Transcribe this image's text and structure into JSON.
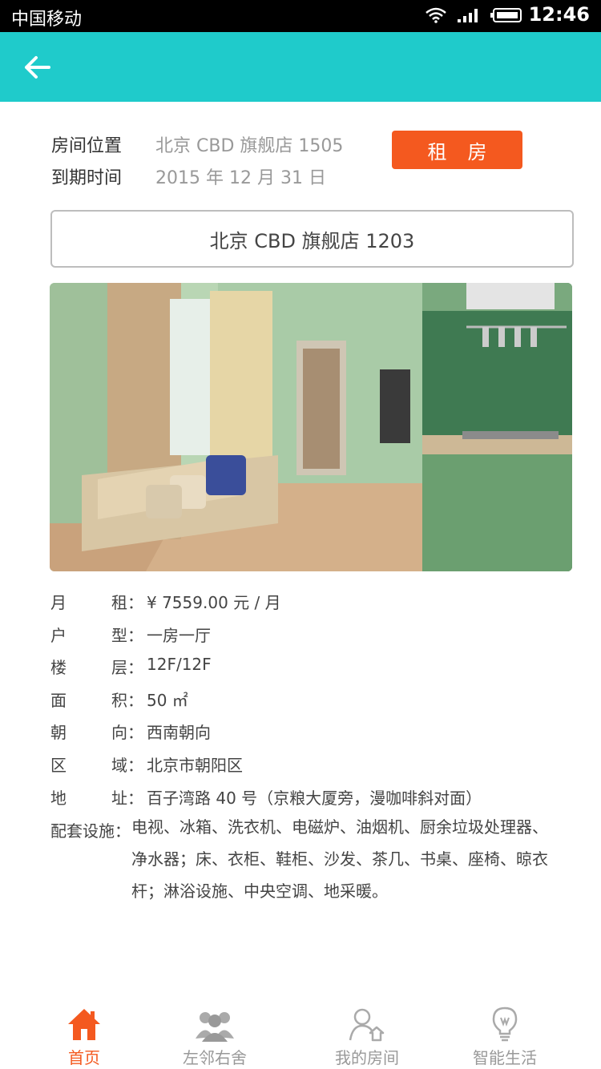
{
  "status_bar": {
    "carrier": "中国移动",
    "time": "12:46"
  },
  "header": {
    "back_icon": "arrow-left-icon"
  },
  "room_info": {
    "location_label": "房间位置",
    "location_value": "北京 CBD 旗舰店 1505",
    "expiry_label": "到期时间",
    "expiry_value": "2015 年 12 月 31 日",
    "rent_button": "租房"
  },
  "room_selector": {
    "value": "北京 CBD 旗舰店 1203"
  },
  "details": [
    {
      "label_a": "月",
      "label_b": "租",
      "value": "¥ 7559.00 元 / 月"
    },
    {
      "label_a": "户",
      "label_b": "型",
      "value": "一房一厅"
    },
    {
      "label_a": "楼",
      "label_b": "层",
      "value": "12F/12F"
    },
    {
      "label_a": "面",
      "label_b": "积",
      "value": "50 ㎡"
    },
    {
      "label_a": "朝",
      "label_b": "向",
      "value": "西南朝向"
    },
    {
      "label_a": "区",
      "label_b": "域",
      "value": "北京市朝阳区"
    },
    {
      "label_a": "地",
      "label_b": "址",
      "value": "百子湾路 40 号（京粮大厦旁，漫咖啡斜对面）"
    }
  ],
  "facilities": {
    "label": "配套设施：",
    "line1": "电视、冰箱、洗衣机、电磁炉、油烟机、厨余垃圾处理器、",
    "line2": "净水器；床、衣柜、鞋柜、沙发、茶几、书桌、座椅、晾衣",
    "line3": "杆；淋浴设施、中央空调、地采暖。"
  },
  "colon": "：",
  "tabs": [
    {
      "label": "首页",
      "icon": "home-icon",
      "active": true
    },
    {
      "label": "左邻右舍",
      "icon": "neighbors-icon",
      "active": false
    },
    {
      "label": "我的房间",
      "icon": "my-room-icon",
      "active": false
    },
    {
      "label": "智能生活",
      "icon": "lightbulb-icon",
      "active": false
    }
  ],
  "colors": {
    "accent": "#1fcbcb",
    "brand_orange": "#f4591f"
  }
}
